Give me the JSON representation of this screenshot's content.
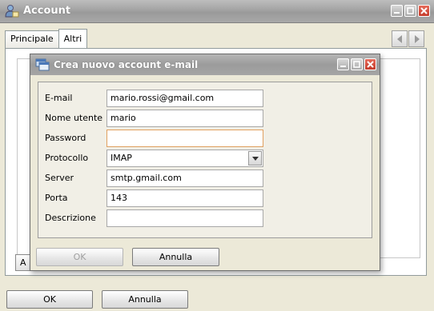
{
  "window": {
    "title": "Account",
    "tabs": [
      "Principale",
      "Altri"
    ],
    "hidden_button_label": "A",
    "ok_label": "OK",
    "cancel_label": "Annulla"
  },
  "dialog": {
    "title": "Crea nuovo account e-mail",
    "fields": {
      "email": {
        "label": "E-mail",
        "value": "mario.rossi@gmail.com"
      },
      "username": {
        "label": "Nome utente",
        "value": "mario"
      },
      "password": {
        "label": "Password",
        "value": ""
      },
      "protocol": {
        "label": "Protocollo",
        "value": "IMAP"
      },
      "server": {
        "label": "Server",
        "value": "smtp.gmail.com"
      },
      "port": {
        "label": "Porta",
        "value": "143"
      },
      "description": {
        "label": "Descrizione",
        "value": ""
      }
    },
    "ok_label": "OK",
    "cancel_label": "Annulla"
  },
  "icons": {
    "app": "account-icon",
    "dialog": "windows-icon",
    "minimize": "minimize-icon",
    "maximize": "maximize-icon",
    "close": "close-icon",
    "prev": "chevron-left-icon",
    "next": "chevron-right-icon",
    "dropdown": "chevron-down-icon"
  },
  "colors": {
    "titlebar": "#a3a3a3",
    "close_button": "#c43b2a",
    "focus_border": "#e0a060",
    "background": "#ece9d8"
  }
}
